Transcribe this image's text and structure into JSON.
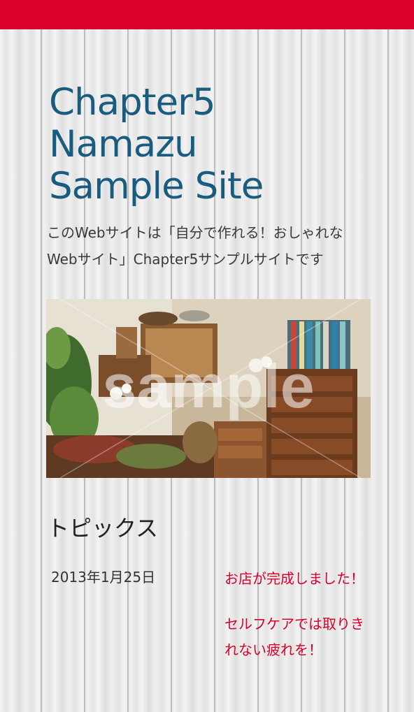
{
  "header": {
    "bar_color": "#d9002b"
  },
  "site": {
    "title_lines": [
      "Chapter5",
      "Namazu",
      "Sample Site"
    ],
    "title_color": "#1a5c7f",
    "description": "このWebサイトは「自分で作れる！おしゃれなWebサイト」Chapter5サンプルサイトです"
  },
  "hero": {
    "watermark": "sample"
  },
  "topics": {
    "heading": "トピックス",
    "date": "2013年1月25日",
    "items": [
      "お店が完成しました！",
      "セルフケアでは取りきれない疲れを！"
    ],
    "link_color": "#d9002b"
  }
}
